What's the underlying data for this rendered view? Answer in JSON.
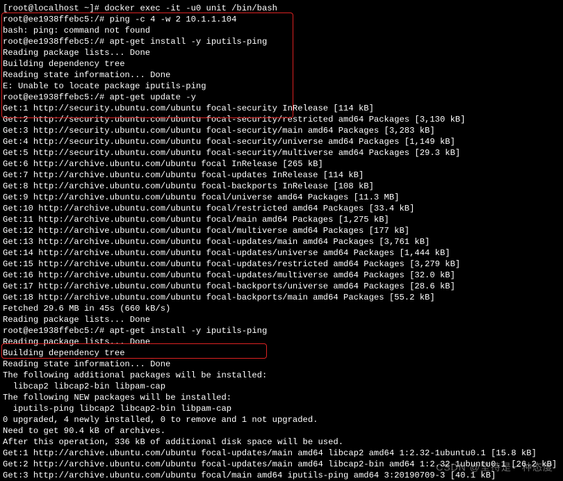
{
  "terminal": {
    "lines": [
      "[root@localhost ~]# docker exec -it -u0 unit /bin/bash",
      "root@ee1938ffebc5:/# ping -c 4 -w 2 10.1.1.104",
      "bash: ping: command not found",
      "root@ee1938ffebc5:/# apt-get install -y iputils-ping",
      "Reading package lists... Done",
      "Building dependency tree",
      "Reading state information... Done",
      "E: Unable to locate package iputils-ping",
      "root@ee1938ffebc5:/# apt-get update -y",
      "Get:1 http://security.ubuntu.com/ubuntu focal-security InRelease [114 kB]",
      "Get:2 http://security.ubuntu.com/ubuntu focal-security/restricted amd64 Packages [3,130 kB]",
      "Get:3 http://security.ubuntu.com/ubuntu focal-security/main amd64 Packages [3,283 kB]",
      "Get:4 http://security.ubuntu.com/ubuntu focal-security/universe amd64 Packages [1,149 kB]",
      "Get:5 http://security.ubuntu.com/ubuntu focal-security/multiverse amd64 Packages [29.3 kB]",
      "Get:6 http://archive.ubuntu.com/ubuntu focal InRelease [265 kB]",
      "Get:7 http://archive.ubuntu.com/ubuntu focal-updates InRelease [114 kB]",
      "Get:8 http://archive.ubuntu.com/ubuntu focal-backports InRelease [108 kB]",
      "Get:9 http://archive.ubuntu.com/ubuntu focal/universe amd64 Packages [11.3 MB]",
      "Get:10 http://archive.ubuntu.com/ubuntu focal/restricted amd64 Packages [33.4 kB]",
      "Get:11 http://archive.ubuntu.com/ubuntu focal/main amd64 Packages [1,275 kB]",
      "Get:12 http://archive.ubuntu.com/ubuntu focal/multiverse amd64 Packages [177 kB]",
      "Get:13 http://archive.ubuntu.com/ubuntu focal-updates/main amd64 Packages [3,761 kB]",
      "Get:14 http://archive.ubuntu.com/ubuntu focal-updates/universe amd64 Packages [1,444 kB]",
      "Get:15 http://archive.ubuntu.com/ubuntu focal-updates/restricted amd64 Packages [3,279 kB]",
      "Get:16 http://archive.ubuntu.com/ubuntu focal-updates/multiverse amd64 Packages [32.0 kB]",
      "Get:17 http://archive.ubuntu.com/ubuntu focal-backports/universe amd64 Packages [28.6 kB]",
      "Get:18 http://archive.ubuntu.com/ubuntu focal-backports/main amd64 Packages [55.2 kB]",
      "Fetched 29.6 MB in 45s (660 kB/s)",
      "Reading package lists... Done",
      "root@ee1938ffebc5:/# apt-get install -y iputils-ping",
      "Reading package lists... Done",
      "Building dependency tree",
      "Reading state information... Done",
      "The following additional packages will be installed:",
      "  libcap2 libcap2-bin libpam-cap",
      "The following NEW packages will be installed:",
      "  iputils-ping libcap2 libcap2-bin libpam-cap",
      "0 upgraded, 4 newly installed, 0 to remove and 1 not upgraded.",
      "Need to get 90.4 kB of archives.",
      "After this operation, 336 kB of additional disk space will be used.",
      "Get:1 http://archive.ubuntu.com/ubuntu focal-updates/main amd64 libcap2 amd64 1:2.32-1ubuntu0.1 [15.8 kB]",
      "Get:2 http://archive.ubuntu.com/ubuntu focal-updates/main amd64 libcap2-bin amd64 1:2.32-1ubuntu0.1 [26.2 kB]",
      "Get:3 http://archive.ubuntu.com/ubuntu focal/main amd64 iputils-ping amd64 3:20190709-3 [40.1 kB]"
    ]
  },
  "watermark": "CSDN @坚持是一种态度"
}
